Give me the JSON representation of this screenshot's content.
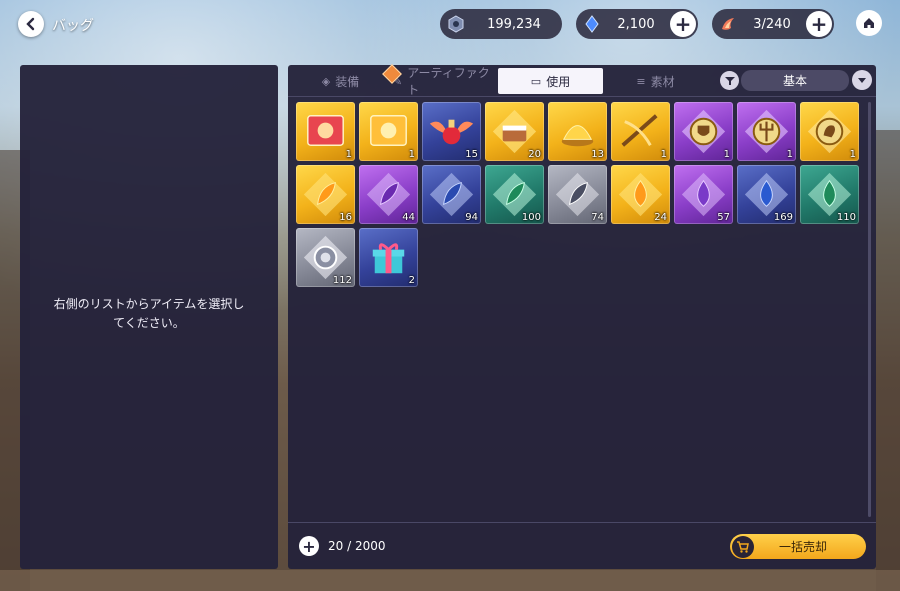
{
  "header": {
    "back_icon": "back-arrow-icon",
    "title": "バッグ",
    "currencies": [
      {
        "name": "coin",
        "icon": "hex-coin-icon",
        "value": "199,234",
        "has_plus": false
      },
      {
        "name": "crystal",
        "icon": "blue-crystal-icon",
        "value": "2,100",
        "has_plus": true
      },
      {
        "name": "stamina",
        "icon": "flame-icon",
        "value": "3/240",
        "has_plus": true
      }
    ],
    "home_icon": "home-icon"
  },
  "left_panel": {
    "hint": "右側のリストからアイテムを選択してください。"
  },
  "tabs": [
    {
      "label": "装備",
      "icon": "equipment-icon",
      "active": false
    },
    {
      "label": "アーティファクト",
      "icon": "artifact-icon",
      "active": false,
      "new_badge": true
    },
    {
      "label": "使用",
      "icon": "consumable-icon",
      "active": true
    },
    {
      "label": "素材",
      "icon": "material-icon",
      "active": false
    }
  ],
  "filter": {
    "icon": "filter-icon",
    "sort_label": "基本",
    "arrow_icon": "chevron-down-icon"
  },
  "items": [
    {
      "icon": "red-ticket-icon",
      "rarity": "gold",
      "count": "1"
    },
    {
      "icon": "gold-ticket-icon",
      "rarity": "gold",
      "count": "1"
    },
    {
      "icon": "winged-potion-icon",
      "rarity": "blue",
      "count": "15"
    },
    {
      "icon": "cake-icon",
      "rarity": "gold",
      "count": "20"
    },
    {
      "icon": "golden-dish-icon",
      "rarity": "gold",
      "count": "13"
    },
    {
      "icon": "crossbow-icon",
      "rarity": "gold",
      "count": "1"
    },
    {
      "icon": "shield-emblem-icon",
      "rarity": "purple",
      "count": "1"
    },
    {
      "icon": "trident-emblem-icon",
      "rarity": "purple",
      "count": "1"
    },
    {
      "icon": "beast-emblem-icon",
      "rarity": "gold",
      "count": "1"
    },
    {
      "icon": "gold-crystal-icon",
      "rarity": "gold",
      "count": "16"
    },
    {
      "icon": "purple-crystal-icon",
      "rarity": "purple",
      "count": "44"
    },
    {
      "icon": "blue-crystal-icon",
      "rarity": "blue",
      "count": "94"
    },
    {
      "icon": "green-crystal-icon",
      "rarity": "teal",
      "count": "100"
    },
    {
      "icon": "white-crystal-icon",
      "rarity": "gray",
      "count": "74"
    },
    {
      "icon": "gold-drop-icon",
      "rarity": "gold",
      "count": "24"
    },
    {
      "icon": "purple-drop-icon",
      "rarity": "purple",
      "count": "57"
    },
    {
      "icon": "blue-drop-icon",
      "rarity": "blue",
      "count": "169"
    },
    {
      "icon": "green-drop-icon",
      "rarity": "teal",
      "count": "110"
    },
    {
      "icon": "silver-orb-icon",
      "rarity": "gray",
      "count": "112"
    },
    {
      "icon": "gift-box-icon",
      "rarity": "blue",
      "count": "2"
    }
  ],
  "footer": {
    "add_icon": "plus-icon",
    "capacity": "20 / 2000",
    "sell_icon": "cart-icon",
    "sell_label": "一括売却"
  },
  "colors": {
    "gold": "#f3b21a",
    "purple": "#8a3ec8",
    "blue": "#34429a",
    "teal": "#217a6a",
    "gray": "#878a98",
    "panel": "#24223a",
    "sell_button": "#f3a71c"
  }
}
